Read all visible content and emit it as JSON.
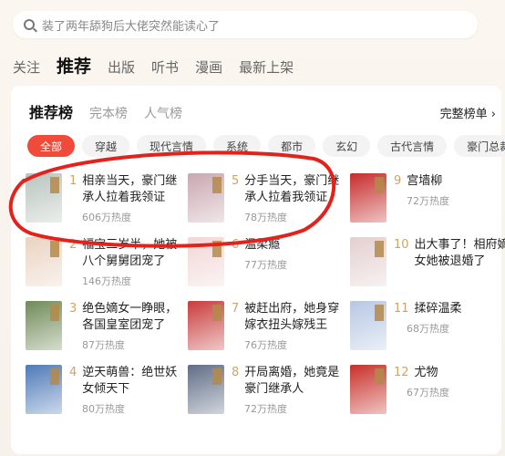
{
  "search": {
    "placeholder": "装了两年舔狗后大佬突然能读心了"
  },
  "top_nav": [
    {
      "label": "关注",
      "active": false
    },
    {
      "label": "推荐",
      "active": true
    },
    {
      "label": "出版",
      "active": false
    },
    {
      "label": "听书",
      "active": false
    },
    {
      "label": "漫画",
      "active": false
    },
    {
      "label": "最新上架",
      "active": false
    }
  ],
  "rank": {
    "tabs": [
      "推荐榜",
      "完本榜",
      "人气榜"
    ],
    "full_list": "完整榜单 ›"
  },
  "chips": [
    "全部",
    "穿越",
    "现代言情",
    "系统",
    "都市",
    "玄幻",
    "古代言情",
    "豪门总裁"
  ],
  "books": [
    {
      "rank": "1",
      "title": "相亲当天，豪门继承人拉着我领证",
      "heat": "606万热度",
      "cover": "#b9c4bd"
    },
    {
      "rank": "2",
      "title": "福宝三岁半，她被八个舅舅团宠了",
      "heat": "146万热度",
      "cover": "#ead3c1"
    },
    {
      "rank": "3",
      "title": "绝色嫡女一睁眼，各国皇室团宠了",
      "heat": "87万热度",
      "cover": "#6f8a58"
    },
    {
      "rank": "4",
      "title": "逆天萌兽：绝世妖女倾天下",
      "heat": "80万热度",
      "cover": "#4e79b8"
    },
    {
      "rank": "5",
      "title": "分手当天，豪门继承人拉着我领证",
      "heat": "78万热度",
      "cover": "#c9a7b0"
    },
    {
      "rank": "6",
      "title": "温柔瘾",
      "heat": "77万热度",
      "cover": "#f2d6d6"
    },
    {
      "rank": "7",
      "title": "被赶出府，她身穿嫁衣扭头嫁残王",
      "heat": "76万热度",
      "cover": "#c83c3c"
    },
    {
      "rank": "8",
      "title": "开局离婚，她竟是豪门继承人",
      "heat": "72万热度",
      "cover": "#5f6d86"
    },
    {
      "rank": "9",
      "title": "宫墙柳",
      "heat": "72万热度",
      "cover": "#c62c2c"
    },
    {
      "rank": "10",
      "title": "出大事了！相府嫡女她被退婚了",
      "heat": "",
      "cover": "#e4cfcf"
    },
    {
      "rank": "11",
      "title": "揉碎温柔",
      "heat": "68万热度",
      "cover": "#b7c7e3"
    },
    {
      "rank": "12",
      "title": "尤物",
      "heat": "67万热度",
      "cover": "#c7302a"
    }
  ],
  "colors": {
    "accent": "#f04b3a",
    "annotation": "#e4221c"
  }
}
